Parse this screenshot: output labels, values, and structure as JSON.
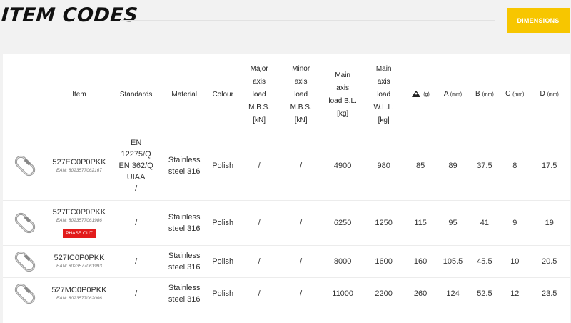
{
  "header": {
    "title": "ITEM CODES",
    "dimensions_label": "DIMENSIONS"
  },
  "columns": {
    "item": "Item",
    "standards": "Standards",
    "material": "Material",
    "colour": "Colour",
    "major": [
      "Major",
      "axis",
      "load",
      "M.B.S.",
      "[kN]"
    ],
    "minor": [
      "Minor",
      "axis",
      "load",
      "M.B.S.",
      "[kN]"
    ],
    "main_bl": [
      "Main",
      "axis",
      "load B.L.",
      "[kg]"
    ],
    "main_wll": [
      "Main",
      "axis",
      "load",
      "W.L.L.",
      "[kg]"
    ],
    "weight_unit": "(g)",
    "a": "A",
    "a_unit": "(mm)",
    "b": "B",
    "b_unit": "(mm)",
    "c": "C",
    "c_unit": "(mm)",
    "d": "D",
    "d_unit": "(mm)"
  },
  "rows": [
    {
      "code": "527EC0P0PKK",
      "ean": "EAN: 8023577062167",
      "standards": [
        "EN",
        "12275/Q",
        "EN 362/Q",
        "UIAA",
        "/"
      ],
      "material": [
        "Stainless",
        "steel 316"
      ],
      "colour": "Polish",
      "major": "/",
      "minor": "/",
      "bl": "4900",
      "wll": "980",
      "weight": "85",
      "a": "89",
      "b": "37.5",
      "c": "8",
      "d": "17.5"
    },
    {
      "code": "527FC0P0PKK",
      "ean": "EAN: 8023577061986",
      "badge": "PHASE OUT",
      "standards": [
        "/"
      ],
      "material": [
        "Stainless",
        "steel 316"
      ],
      "colour": "Polish",
      "major": "/",
      "minor": "/",
      "bl": "6250",
      "wll": "1250",
      "weight": "115",
      "a": "95",
      "b": "41",
      "c": "9",
      "d": "19"
    },
    {
      "code": "527IC0P0PKK",
      "ean": "EAN: 8023577061993",
      "standards": [
        "/"
      ],
      "material": [
        "Stainless",
        "steel 316"
      ],
      "colour": "Polish",
      "major": "/",
      "minor": "/",
      "bl": "8000",
      "wll": "1600",
      "weight": "160",
      "a": "105.5",
      "b": "45.5",
      "c": "10",
      "d": "20.5"
    },
    {
      "code": "527MC0P0PKK",
      "ean": "EAN: 8023577062006",
      "standards": [
        "/"
      ],
      "material": [
        "Stainless",
        "steel 316"
      ],
      "colour": "Polish",
      "major": "/",
      "minor": "/",
      "bl": "11000",
      "wll": "2200",
      "weight": "260",
      "a": "124",
      "b": "52.5",
      "c": "12",
      "d": "23.5"
    }
  ]
}
